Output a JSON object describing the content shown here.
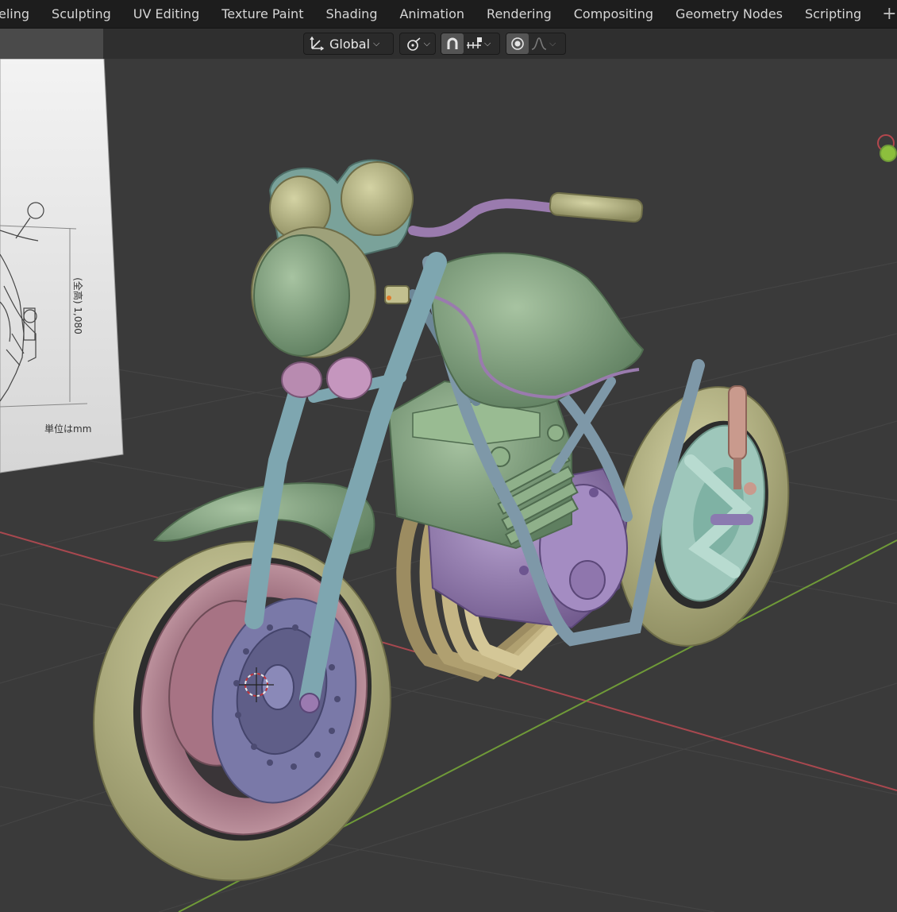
{
  "workspace_tabs": [
    "eling",
    "Sculpting",
    "UV Editing",
    "Texture Paint",
    "Shading",
    "Animation",
    "Rendering",
    "Compositing",
    "Geometry Nodes",
    "Scripting"
  ],
  "add_tab_label": "+",
  "viewport_header": {
    "transform_orientation": "Global",
    "icons": [
      "transform-orientation-icon",
      "pivot-point-icon",
      "snap-magnet-icon",
      "snap-increment-icon",
      "proportional-editing-icon",
      "falloff-curve-icon"
    ]
  },
  "reference_image": {
    "dimension_label": "(全高) 1,080",
    "unit_label": "単位はmm"
  },
  "colors": {
    "topbar": "#1d1d1d",
    "viewport_bg": "#3a3a3a",
    "x_axis": "#a8484f",
    "y_axis": "#6f9a38",
    "body_green": "#7fa07e",
    "frame_blue": "#7e98a8",
    "tire_olive": "#b9b98a",
    "engine_purple": "#9a82b6",
    "rim_pink": "#b88c98"
  }
}
